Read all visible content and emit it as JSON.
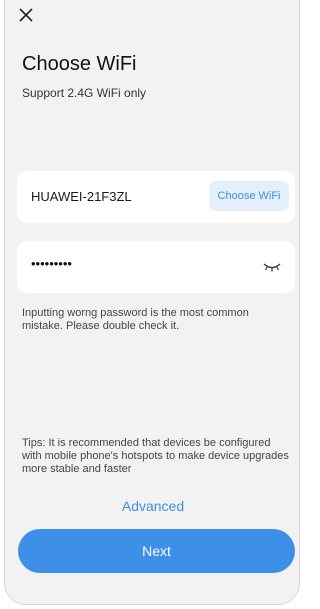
{
  "header": {
    "close_icon": "close-icon",
    "title": "Choose WiFi",
    "subtitle": "Support 2.4G WiFi only"
  },
  "wifi": {
    "ssid": "HUAWEI-21F3ZL",
    "choose_label": "Choose WiFi"
  },
  "password": {
    "masked_value": "•••••••••",
    "toggle_icon": "eye-closed-icon"
  },
  "messages": {
    "warning": "Inputting worng password is the most common mistake. Please double check it.",
    "tips": "Tips: It is recommended that devices be configured with mobile phone's hotspots to make device upgrades more stable and faster"
  },
  "actions": {
    "advanced_label": "Advanced",
    "next_label": "Next"
  },
  "colors": {
    "accent": "#3d8fe8",
    "background": "#f2f2f2"
  }
}
